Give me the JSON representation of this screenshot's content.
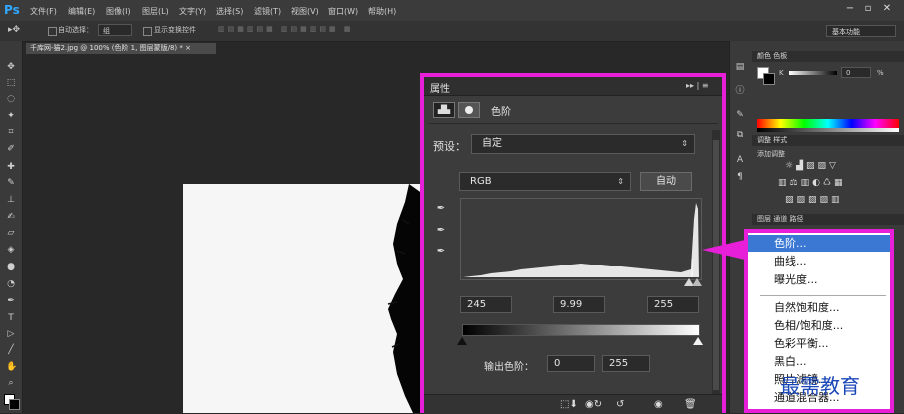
{
  "app": {
    "logo": "Ps"
  },
  "menu": [
    "文件(F)",
    "编辑(E)",
    "图像(I)",
    "图层(L)",
    "文字(Y)",
    "选择(S)",
    "滤镜(T)",
    "视图(V)",
    "窗口(W)",
    "帮助(H)"
  ],
  "window_controls": [
    "−",
    "▫",
    "✕"
  ],
  "options_bar": {
    "auto_select_label": "自动选择：",
    "auto_select_value": "组",
    "show_transform_label": "显示变换控件",
    "workspace": "基本功能"
  },
  "document": {
    "tab_title": "千库网-猫2.jpg @ 100% (色阶 1, 图层蒙版/8) * ×"
  },
  "properties": {
    "title": "属性",
    "controls": "▸▸ | ≡",
    "adjustment_title": "色阶",
    "preset_label": "预设：",
    "preset_value": "自定",
    "channel_value": "RGB",
    "auto_button": "自动",
    "input_black": "245",
    "input_gamma": "9.99",
    "input_white": "255",
    "output_label": "输出色阶：",
    "output_black": "0",
    "output_white": "255"
  },
  "right_panels": {
    "color_tabs": "颜色  色板",
    "k_label": "K",
    "k_value": "0",
    "k_unit": "%",
    "adjust_tabs": "调整  样式",
    "adjust_sub": "添加调整",
    "layers_tabs": "图层  通道  路径"
  },
  "adjustment_menu": {
    "items": [
      "色阶...",
      "曲线...",
      "曝光度...",
      "自然饱和度...",
      "色相/饱和度...",
      "色彩平衡...",
      "黑白...",
      "照片滤镜...",
      "通道混合器..."
    ],
    "selected": 0
  },
  "watermark": "最需教育",
  "colors": {
    "highlight": "#e81fd8",
    "menu_selected": "#3a78d4",
    "ps_blue": "#31a8ff"
  }
}
